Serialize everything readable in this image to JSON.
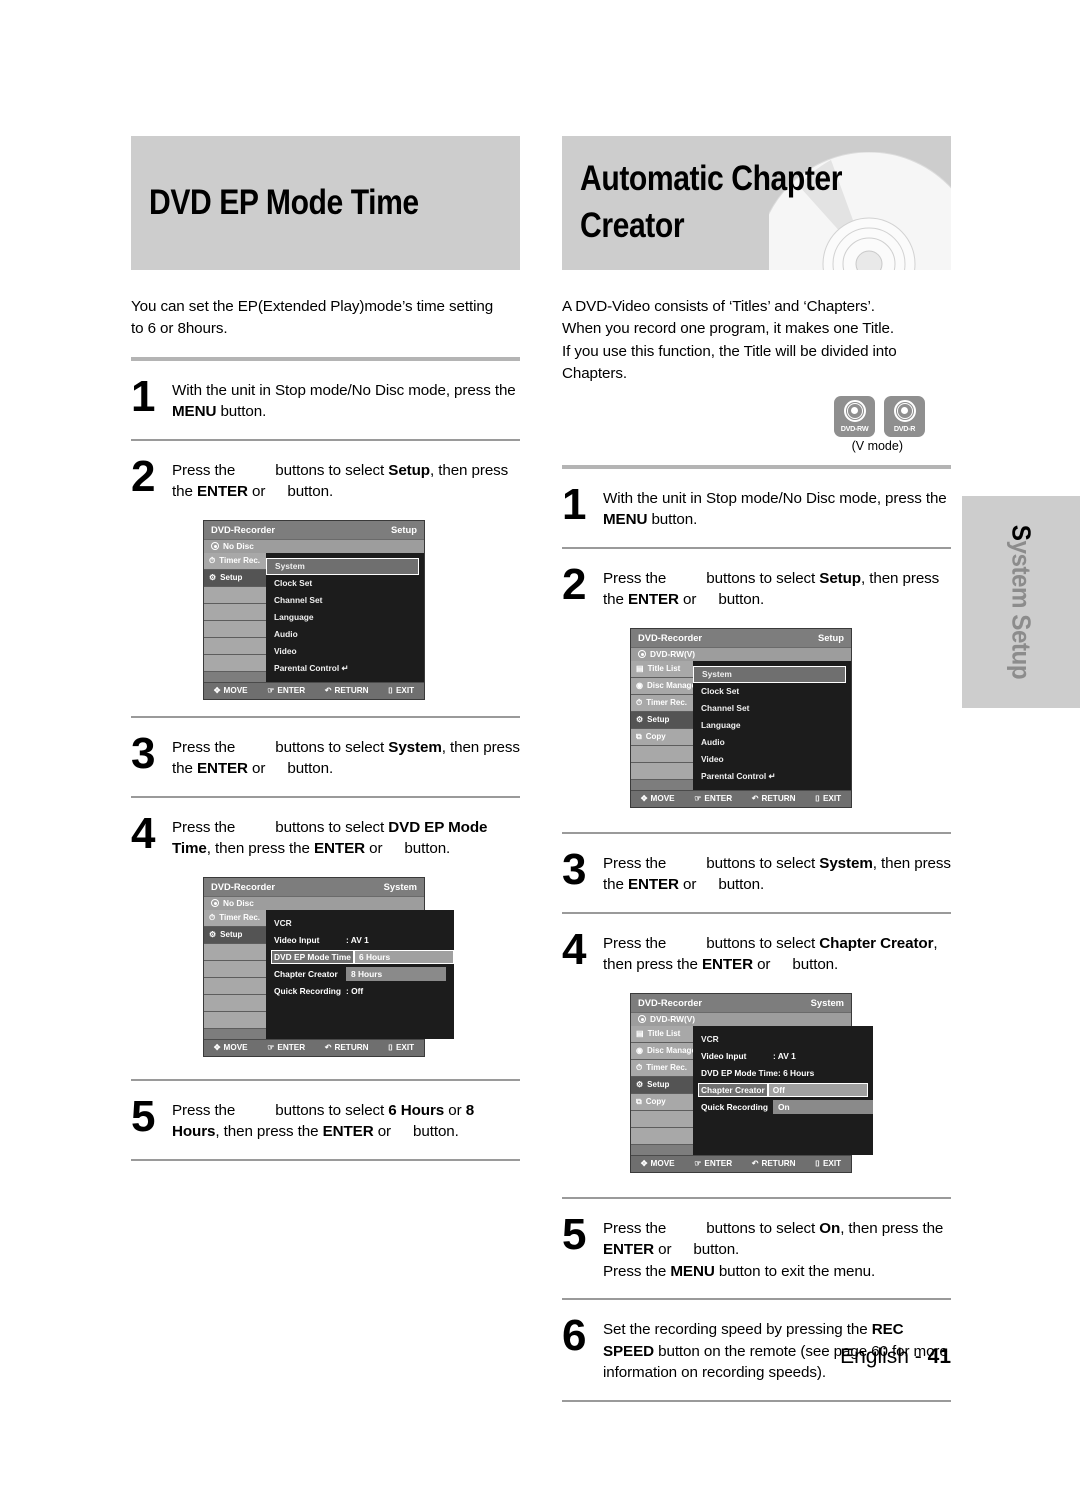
{
  "left": {
    "banner_title": "DVD EP Mode Time",
    "intro_lines": [
      "You can set the EP(Extended Play)mode’s time setting",
      "to 6 or 8hours."
    ],
    "steps": [
      {
        "num": "1",
        "parts": [
          {
            "t": "With the unit in Stop mode/No Disc mode, press the "
          },
          {
            "t": "MENU",
            "b": true
          },
          {
            "t": " button."
          }
        ]
      },
      {
        "num": "2",
        "parts": [
          {
            "t": "Press the"
          },
          {
            "gap": true
          },
          {
            "t": "buttons to select "
          },
          {
            "t": "Setup",
            "b": true
          },
          {
            "t": ", then press the "
          },
          {
            "t": "ENTER",
            "b": true
          },
          {
            "t": " or"
          },
          {
            "gapsm": true
          },
          {
            "t": "button."
          }
        ]
      },
      {
        "num": "3",
        "parts": [
          {
            "t": "Press the"
          },
          {
            "gap": true
          },
          {
            "t": "buttons to select "
          },
          {
            "t": "System",
            "b": true
          },
          {
            "t": ", then press the "
          },
          {
            "t": "ENTER",
            "b": true
          },
          {
            "t": " or"
          },
          {
            "gapsm": true
          },
          {
            "t": "button."
          }
        ]
      },
      {
        "num": "4",
        "parts": [
          {
            "t": "Press the"
          },
          {
            "gap": true
          },
          {
            "t": "buttons to select "
          },
          {
            "t": "DVD EP Mode Time",
            "b": true
          },
          {
            "t": ", then press the "
          },
          {
            "t": "ENTER",
            "b": true
          },
          {
            "t": " or"
          },
          {
            "gapsm": true
          },
          {
            "t": "button."
          }
        ]
      },
      {
        "num": "5",
        "parts": [
          {
            "t": "Press the"
          },
          {
            "gap": true
          },
          {
            "t": "buttons to select "
          },
          {
            "t": "6 Hours",
            "b": true
          },
          {
            "t": " or "
          },
          {
            "t": "8 Hours",
            "b": true
          },
          {
            "t": ", then press the "
          },
          {
            "t": "ENTER",
            "b": true
          },
          {
            "t": " or"
          },
          {
            "gapsm": true
          },
          {
            "t": "button."
          }
        ]
      }
    ]
  },
  "right": {
    "banner_title": "Automatic Chapter\nCreator",
    "intro_lines": [
      "A DVD-Video consists of ‘Titles’ and ‘Chapters’.",
      "When you record one program, it makes one Title.",
      "If you use this function, the Title will be divided into",
      "Chapters."
    ],
    "badges": [
      {
        "label": "DVD-RW"
      },
      {
        "label": "DVD-R"
      }
    ],
    "badge_note": "(V mode)",
    "steps": [
      {
        "num": "1",
        "parts": [
          {
            "t": "With the unit in Stop mode/No Disc mode, press the "
          },
          {
            "t": "MENU",
            "b": true
          },
          {
            "t": " button."
          }
        ]
      },
      {
        "num": "2",
        "parts": [
          {
            "t": "Press the"
          },
          {
            "gap": true
          },
          {
            "t": "buttons to select "
          },
          {
            "t": "Setup",
            "b": true
          },
          {
            "t": ", then press the "
          },
          {
            "t": "ENTER",
            "b": true
          },
          {
            "t": " or"
          },
          {
            "gapsm": true
          },
          {
            "t": "button."
          }
        ]
      },
      {
        "num": "3",
        "parts": [
          {
            "t": "Press the"
          },
          {
            "gap": true
          },
          {
            "t": "buttons to select "
          },
          {
            "t": "System",
            "b": true
          },
          {
            "t": ", then press the "
          },
          {
            "t": "ENTER",
            "b": true
          },
          {
            "t": " or"
          },
          {
            "gapsm": true
          },
          {
            "t": "button."
          }
        ]
      },
      {
        "num": "4",
        "parts": [
          {
            "t": "Press the"
          },
          {
            "gap": true
          },
          {
            "t": "buttons to select "
          },
          {
            "t": "Chapter Creator",
            "b": true
          },
          {
            "t": ", then press the "
          },
          {
            "t": "ENTER",
            "b": true
          },
          {
            "t": " or"
          },
          {
            "gapsm": true
          },
          {
            "t": "button."
          }
        ]
      },
      {
        "num": "5",
        "parts": [
          {
            "t": "Press the"
          },
          {
            "gap": true
          },
          {
            "t": "buttons to select "
          },
          {
            "t": "On",
            "b": true
          },
          {
            "t": ", then press the "
          },
          {
            "t": "ENTER",
            "b": true
          },
          {
            "t": " or"
          },
          {
            "gapsm": true
          },
          {
            "t": "button."
          },
          {
            "br": true
          },
          {
            "t": "Press the "
          },
          {
            "t": "MENU",
            "b": true
          },
          {
            "t": " button to exit the menu."
          }
        ]
      },
      {
        "num": "6",
        "parts": [
          {
            "t": "Set the recording speed by pressing the "
          },
          {
            "t": "REC SPEED",
            "b": true
          },
          {
            "t": " button on the remote (see page 60 for more information on recording speeds)."
          }
        ]
      }
    ]
  },
  "osd": {
    "foot": [
      {
        "icon": "dpad-icon",
        "glyph": "✥",
        "label": "MOVE"
      },
      {
        "icon": "enter-icon",
        "glyph": "☞",
        "label": "ENTER"
      },
      {
        "icon": "return-icon",
        "glyph": "↶",
        "label": "RETURN"
      },
      {
        "icon": "exit-icon",
        "glyph": "⌷",
        "label": "EXIT"
      }
    ],
    "setup_no_disc": {
      "brand": "DVD-Recorder",
      "mode": "Setup",
      "disc": "No Disc",
      "side": [
        "Timer Rec.",
        "Setup"
      ],
      "side_selected": "Setup",
      "menu": [
        "System",
        "Clock Set",
        "Channel Set",
        "Language",
        "Audio",
        "Video",
        "Parental Control"
      ],
      "menu_highlight": "System"
    },
    "system_no_disc": {
      "brand": "DVD-Recorder",
      "mode": "System",
      "disc": "No Disc",
      "side": [
        "Timer Rec.",
        "Setup"
      ],
      "side_selected": "Setup",
      "header": "VCR",
      "rows": [
        {
          "key": "Video Input",
          "value": ": AV 1"
        },
        {
          "key": "DVD EP Mode Time",
          "value": "6 Hours",
          "boxed": true
        },
        {
          "key": "Chapter Creator",
          "value": "8 Hours",
          "option": true
        },
        {
          "key": "Quick Recording",
          "value": ": Off"
        }
      ]
    },
    "setup_dvdrw": {
      "brand": "DVD-Recorder",
      "mode": "Setup",
      "disc": "DVD-RW(V)",
      "side": [
        "Title List",
        "Disc Manager",
        "Timer Rec.",
        "Setup",
        "Copy"
      ],
      "side_selected": "Setup",
      "menu": [
        "System",
        "Clock Set",
        "Channel Set",
        "Language",
        "Audio",
        "Video",
        "Parental Control"
      ],
      "menu_highlight": "System"
    },
    "system_dvdrw": {
      "brand": "DVD-Recorder",
      "mode": "System",
      "disc": "DVD-RW(V)",
      "side": [
        "Title List",
        "Disc Manager",
        "Timer Rec.",
        "Setup",
        "Copy"
      ],
      "side_selected": "Setup",
      "header": "VCR",
      "rows": [
        {
          "key": "Video Input",
          "value": ": AV 1"
        },
        {
          "key": "DVD EP Mode Time",
          "value": ": 6 Hours"
        },
        {
          "key": "Chapter Creator",
          "value": "Off",
          "boxed": true
        },
        {
          "key": "Quick Recording",
          "value": "On",
          "option": true
        }
      ]
    }
  },
  "side_tab": {
    "first_letter": "S",
    "rest": "ystem Setup"
  },
  "footer": {
    "language": "English - ",
    "page": "41"
  }
}
